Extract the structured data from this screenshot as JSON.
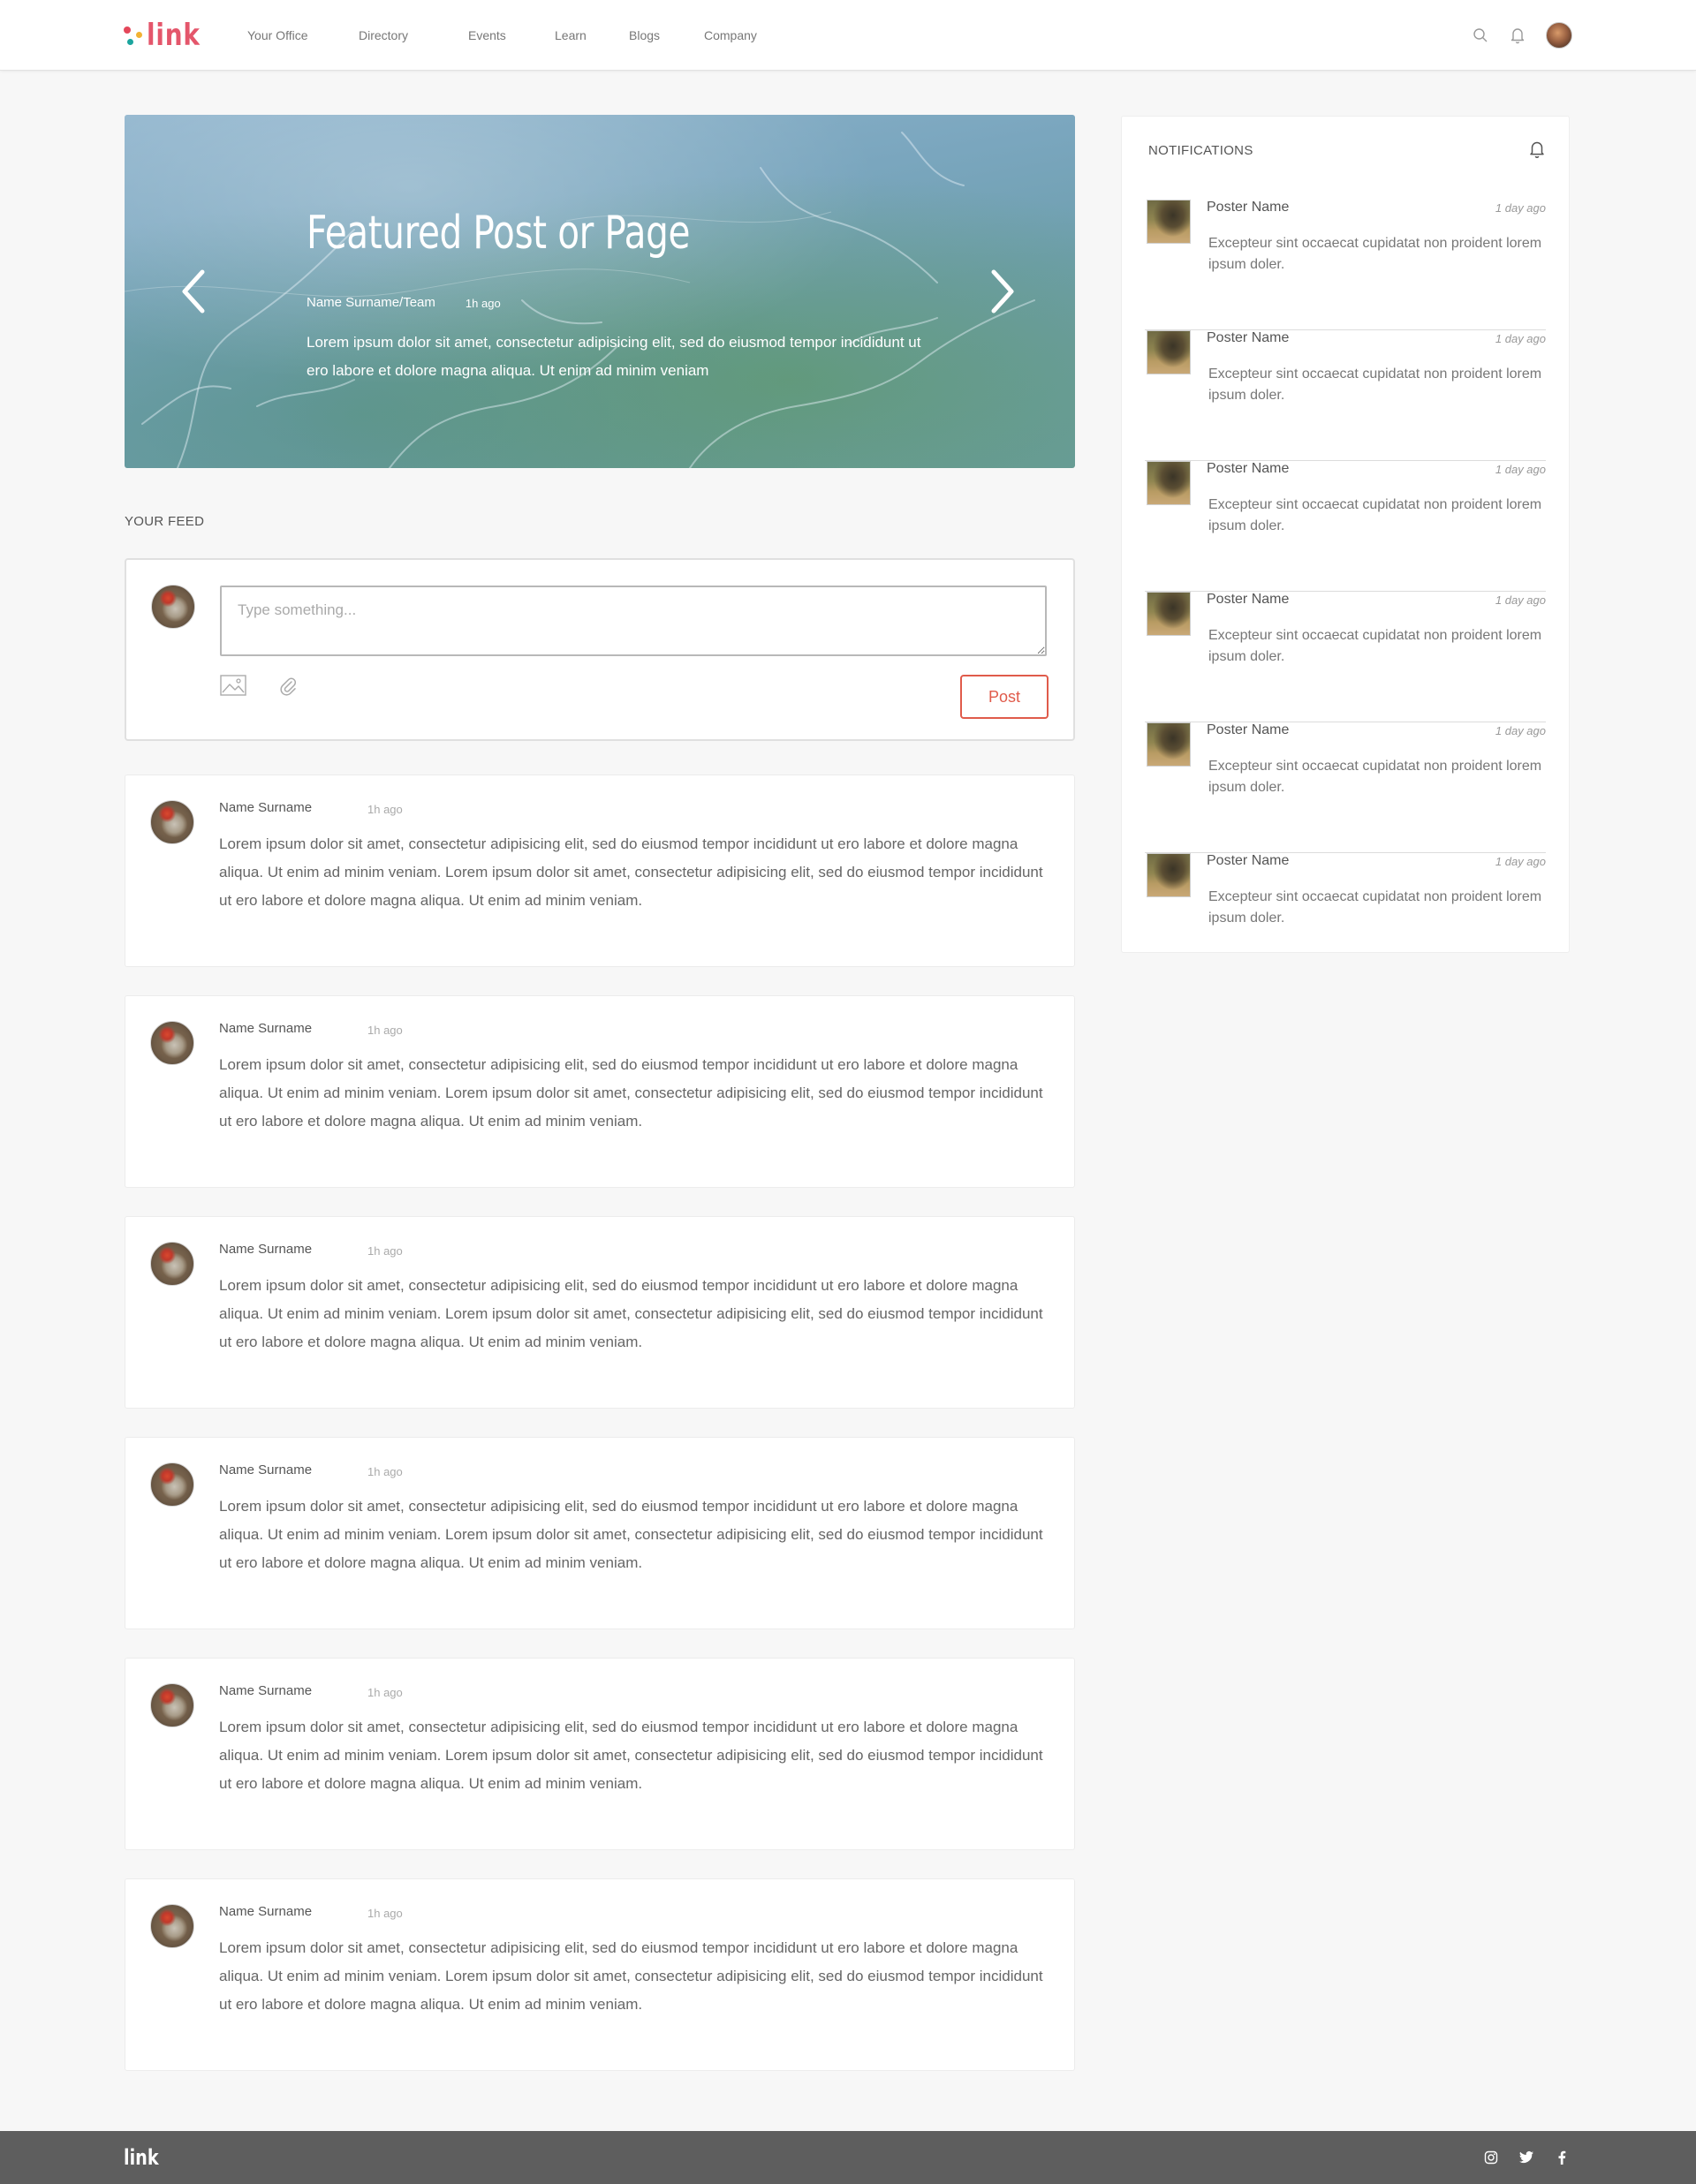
{
  "brand": {
    "logo_text": "link",
    "accent_color": "#e4566b"
  },
  "nav": {
    "items": [
      "Your Office",
      "Directory",
      "Events",
      "Learn",
      "Blogs",
      "Company"
    ]
  },
  "header_icons": [
    "search-icon",
    "bell-icon",
    "user-avatar"
  ],
  "hero": {
    "title": "Featured Post or Page",
    "author": "Name Surname/Team",
    "time": "1h ago",
    "body": "Lorem ipsum dolor sit amet, consectetur adipisicing elit, sed do eiusmod tempor incididunt ut ero labore et dolore magna aliqua. Ut enim ad minim veniam"
  },
  "feed": {
    "section_label": "YOUR FEED",
    "composer": {
      "placeholder": "Type something...",
      "post_label": "Post",
      "accent_color": "#e05b4b"
    },
    "posts": [
      {
        "name": "Name Surname",
        "time": "1h ago",
        "text": "Lorem ipsum dolor sit amet, consectetur adipisicing elit, sed do eiusmod tempor incididunt ut ero labore et dolore magna aliqua. Ut enim ad minim veniam. Lorem ipsum dolor sit amet, consectetur adipisicing elit, sed do eiusmod tempor incididunt ut ero labore et dolore magna aliqua. Ut enim ad minim veniam."
      },
      {
        "name": "Name Surname",
        "time": "1h ago",
        "text": "Lorem ipsum dolor sit amet, consectetur adipisicing elit, sed do eiusmod tempor incididunt ut ero labore et dolore magna aliqua. Ut enim ad minim veniam. Lorem ipsum dolor sit amet, consectetur adipisicing elit, sed do eiusmod tempor incididunt ut ero labore et dolore magna aliqua. Ut enim ad minim veniam."
      },
      {
        "name": "Name Surname",
        "time": "1h ago",
        "text": "Lorem ipsum dolor sit amet, consectetur adipisicing elit, sed do eiusmod tempor incididunt ut ero labore et dolore magna aliqua. Ut enim ad minim veniam. Lorem ipsum dolor sit amet, consectetur adipisicing elit, sed do eiusmod tempor incididunt ut ero labore et dolore magna aliqua. Ut enim ad minim veniam."
      },
      {
        "name": "Name Surname",
        "time": "1h ago",
        "text": "Lorem ipsum dolor sit amet, consectetur adipisicing elit, sed do eiusmod tempor incididunt ut ero labore et dolore magna aliqua. Ut enim ad minim veniam. Lorem ipsum dolor sit amet, consectetur adipisicing elit, sed do eiusmod tempor incididunt ut ero labore et dolore magna aliqua. Ut enim ad minim veniam."
      },
      {
        "name": "Name Surname",
        "time": "1h ago",
        "text": "Lorem ipsum dolor sit amet, consectetur adipisicing elit, sed do eiusmod tempor incididunt ut ero labore et dolore magna aliqua. Ut enim ad minim veniam. Lorem ipsum dolor sit amet, consectetur adipisicing elit, sed do eiusmod tempor incididunt ut ero labore et dolore magna aliqua. Ut enim ad minim veniam."
      },
      {
        "name": "Name Surname",
        "time": "1h ago",
        "text": "Lorem ipsum dolor sit amet, consectetur adipisicing elit, sed do eiusmod tempor incididunt ut ero labore et dolore magna aliqua. Ut enim ad minim veniam. Lorem ipsum dolor sit amet, consectetur adipisicing elit, sed do eiusmod tempor incididunt ut ero labore et dolore magna aliqua. Ut enim ad minim veniam."
      }
    ]
  },
  "notifications": {
    "title": "NOTIFICATIONS",
    "items": [
      {
        "name": "Poster Name",
        "time": "1 day ago",
        "text": "Excepteur sint occaecat cupidatat non proident lorem ipsum doler."
      },
      {
        "name": "Poster Name",
        "time": "1 day ago",
        "text": "Excepteur sint occaecat cupidatat non proident lorem ipsum doler."
      },
      {
        "name": "Poster Name",
        "time": "1 day ago",
        "text": "Excepteur sint occaecat cupidatat non proident lorem ipsum doler."
      },
      {
        "name": "Poster Name",
        "time": "1 day ago",
        "text": "Excepteur sint occaecat cupidatat non proident lorem ipsum doler."
      },
      {
        "name": "Poster Name",
        "time": "1 day ago",
        "text": "Excepteur sint occaecat cupidatat non proident lorem ipsum doler."
      },
      {
        "name": "Poster Name",
        "time": "1 day ago",
        "text": "Excepteur sint occaecat cupidatat non proident lorem ipsum doler."
      }
    ]
  },
  "footer": {
    "logo_text": "link",
    "social_icons": [
      "instagram-icon",
      "twitter-icon",
      "facebook-icon"
    ]
  }
}
